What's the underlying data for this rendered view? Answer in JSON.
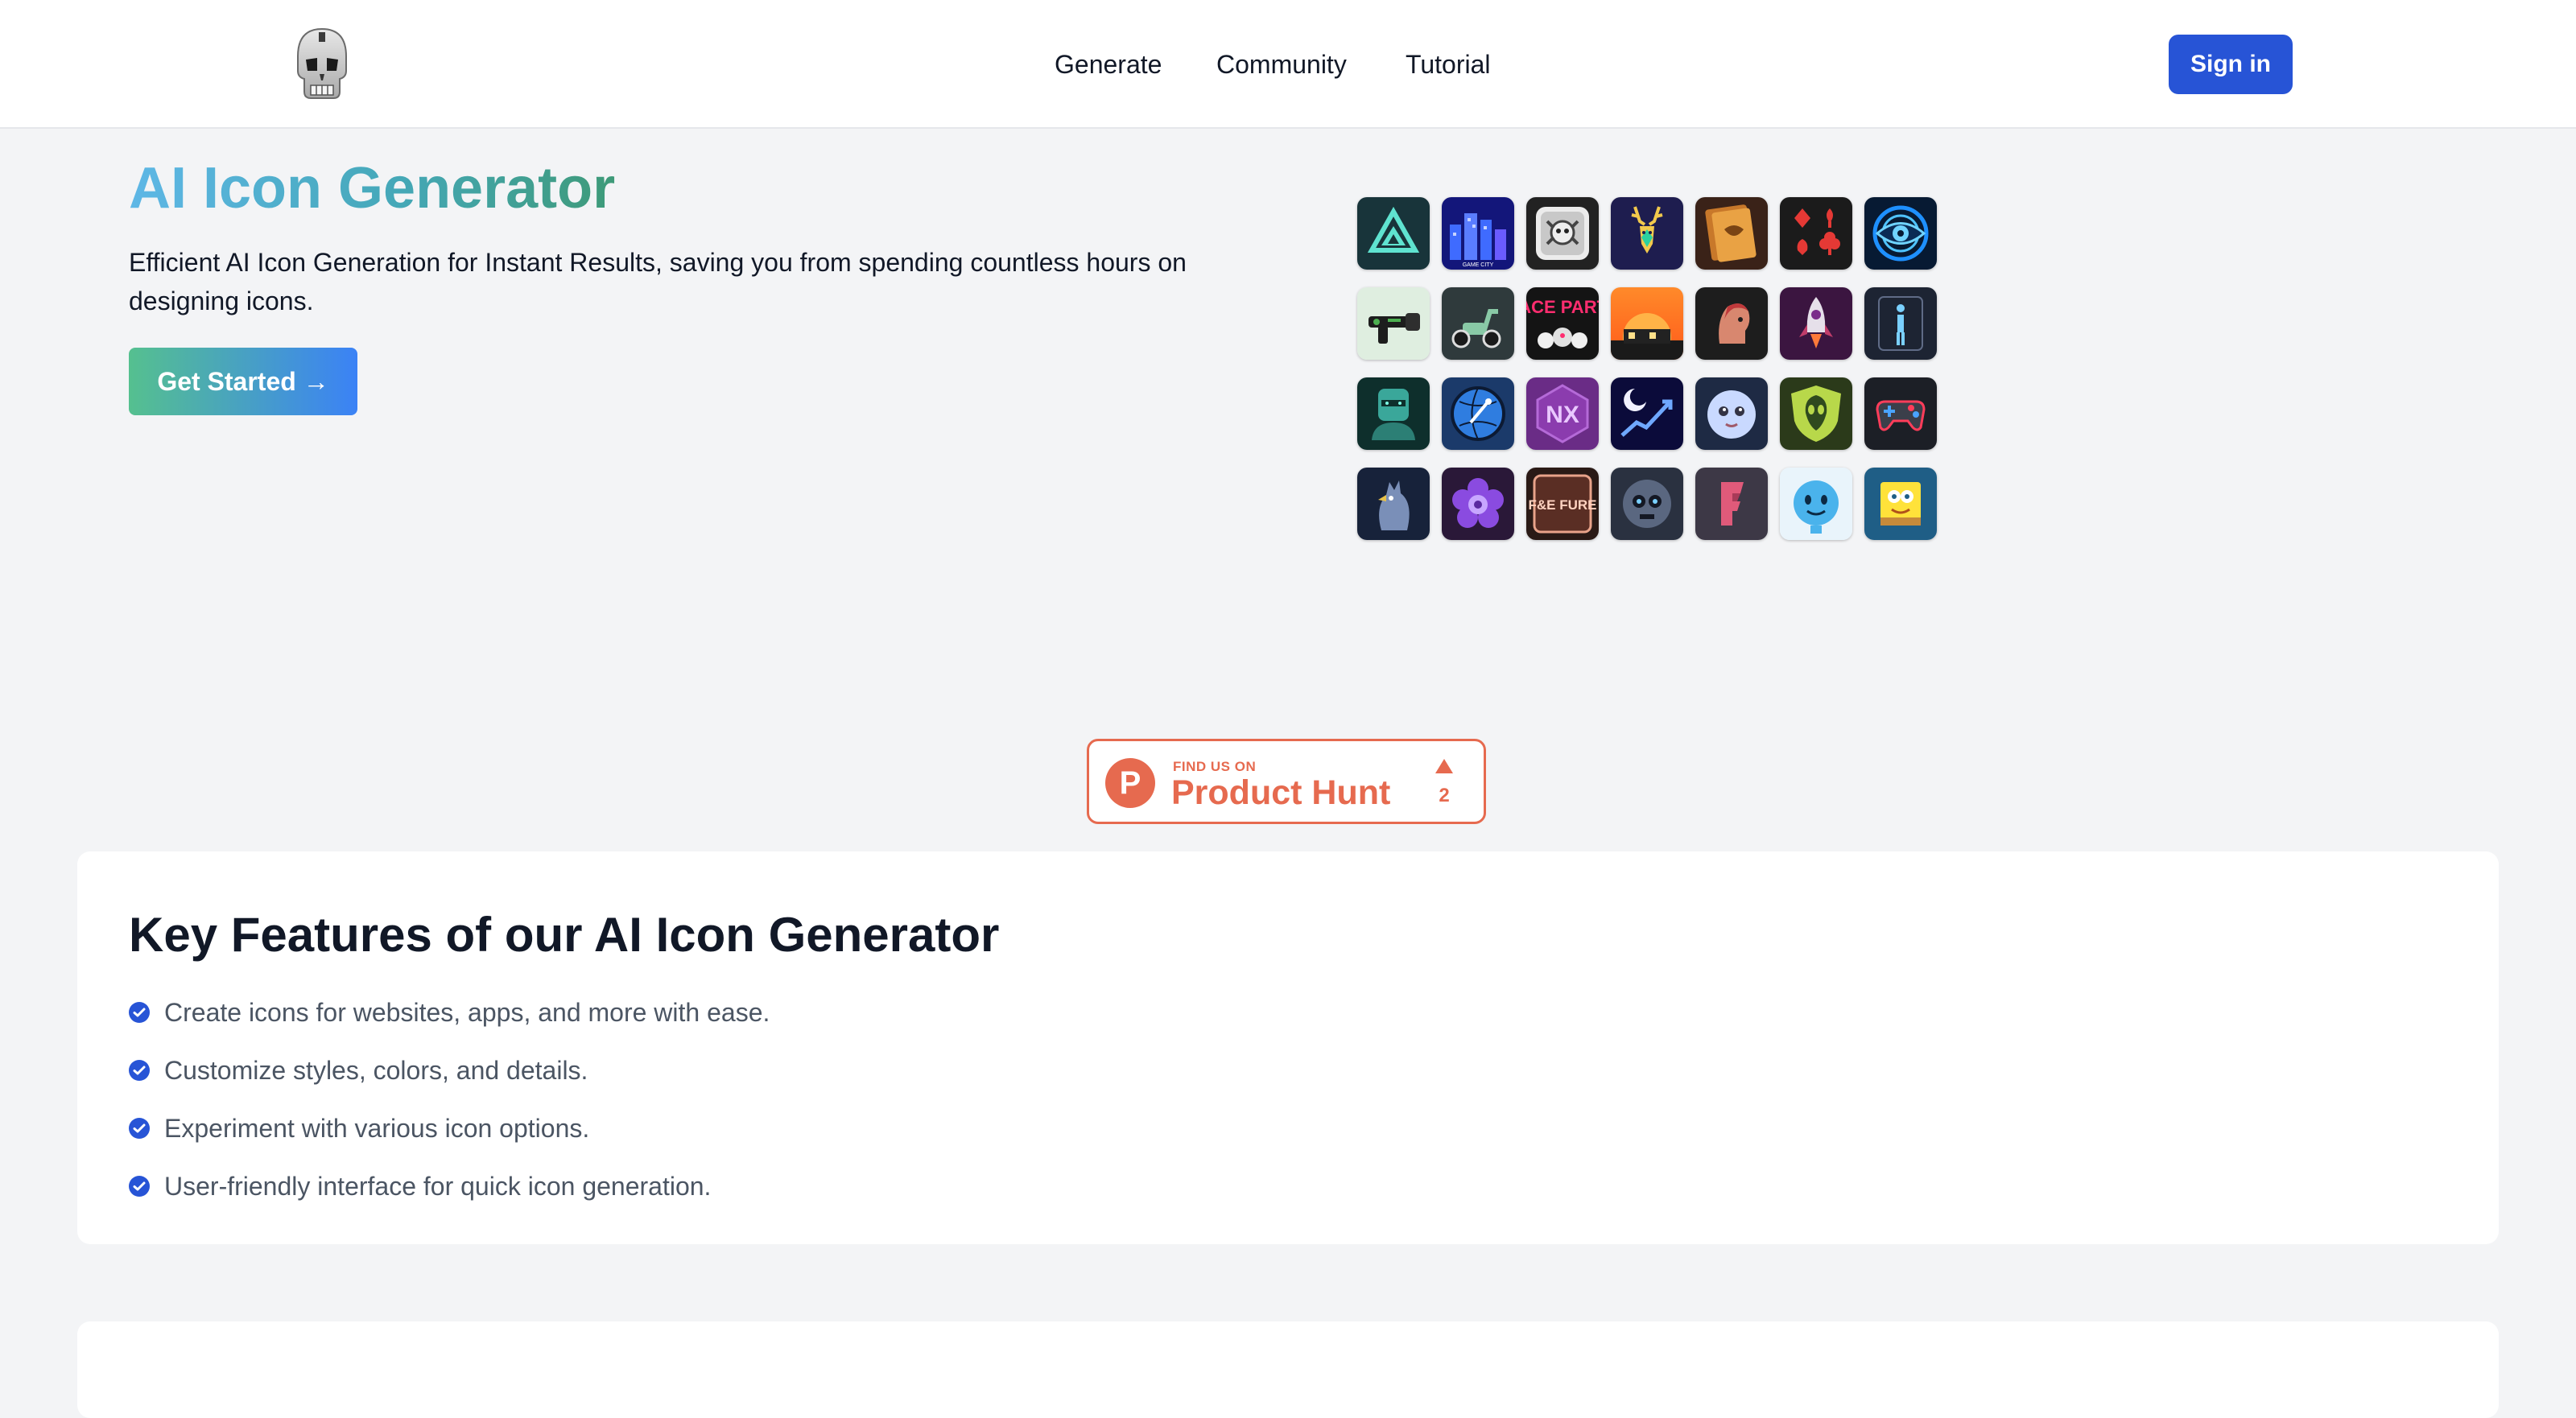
{
  "nav": {
    "links": [
      {
        "label": "Generate"
      },
      {
        "label": "Community"
      },
      {
        "label": "Tutorial"
      }
    ],
    "signin_label": "Sign in"
  },
  "hero": {
    "title": "AI Icon Generator",
    "description": "Efficient AI Icon Generation for Instant Results, saving you from spending countless hours on designing icons.",
    "cta_label": "Get Started →",
    "title_gradient": [
      "#5eb7e6",
      "#45a8b8",
      "#3e9a78"
    ],
    "cta_gradient": [
      "#55c08f",
      "#3b82f6"
    ]
  },
  "icon_grid": {
    "tiles": [
      {
        "name": "triangle-logo-icon"
      },
      {
        "name": "game-city-icon",
        "caption": "GAME CITY"
      },
      {
        "name": "robot-skull-icon"
      },
      {
        "name": "stag-icon"
      },
      {
        "name": "book-icon"
      },
      {
        "name": "playing-cards-icon"
      },
      {
        "name": "blue-eye-icon"
      },
      {
        "name": "ray-gun-icon"
      },
      {
        "name": "scooter-icon"
      },
      {
        "name": "race-party-icon",
        "caption": "RACE PARTY"
      },
      {
        "name": "sunset-house-icon"
      },
      {
        "name": "head-profile-icon"
      },
      {
        "name": "rocket-icon"
      },
      {
        "name": "figure-icon"
      },
      {
        "name": "cyborg-icon"
      },
      {
        "name": "globe-diver-icon"
      },
      {
        "name": "nx-icon",
        "caption": "NX"
      },
      {
        "name": "moon-chart-icon"
      },
      {
        "name": "baby-face-icon"
      },
      {
        "name": "alien-shield-icon"
      },
      {
        "name": "gamepad-icon"
      },
      {
        "name": "rooster-icon"
      },
      {
        "name": "flower-icon"
      },
      {
        "name": "fure-icon",
        "caption": "F&E FURE"
      },
      {
        "name": "skull-orb-icon"
      },
      {
        "name": "letter-f-icon"
      },
      {
        "name": "blue-smiley-icon"
      },
      {
        "name": "sponge-icon"
      }
    ]
  },
  "product_hunt": {
    "small": "FIND US ON",
    "big": "Product Hunt",
    "count": "2",
    "letter": "P",
    "color": "#e66a4f"
  },
  "features": {
    "title": "Key Features of our AI Icon Generator",
    "items": [
      {
        "text": "Create icons for websites, apps, and more with ease."
      },
      {
        "text": "Customize styles, colors, and details."
      },
      {
        "text": "Experiment with various icon options."
      },
      {
        "text": "User-friendly interface for quick icon generation."
      }
    ]
  },
  "colors": {
    "accent": "#2754d6",
    "background": "#f3f4f6"
  }
}
